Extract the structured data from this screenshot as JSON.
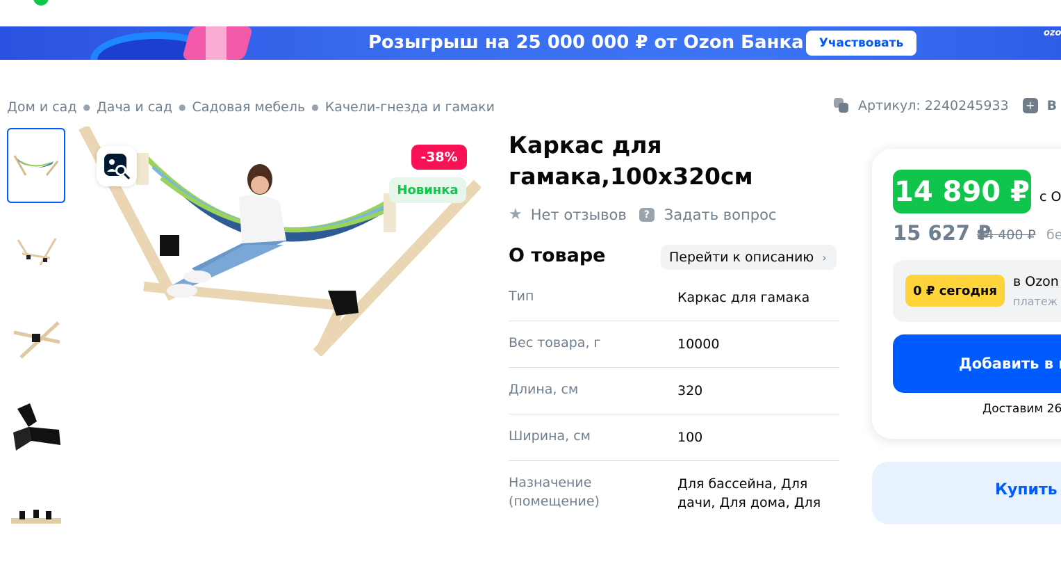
{
  "banner": {
    "title": "Розыгрыш на 25 000 000 ₽ от Ozon Банка",
    "button": "Участвовать",
    "brand": "ozon"
  },
  "breadcrumbs": [
    "Дом и сад",
    "Дача и сад",
    "Садовая мебель",
    "Качели-гнезда и гамаки"
  ],
  "article": {
    "label": "Артикул: 2240245933",
    "partial": "В"
  },
  "badges": {
    "discount": "-38%",
    "new": "Новинка"
  },
  "product": {
    "title": "Каркас для гамака,100x320см",
    "reviews": "Нет отзывов",
    "ask": "Задать вопрос"
  },
  "about": {
    "heading": "О товаре",
    "link": "Перейти к описанию",
    "specs": [
      {
        "key": "Тип",
        "value": "Каркас для гамака"
      },
      {
        "key": "Вес товара, г",
        "value": "10000"
      },
      {
        "key": "Длина, см",
        "value": "320"
      },
      {
        "key": "Ширина, см",
        "value": "100"
      },
      {
        "key": "Назначение (помещение)",
        "value": "Для бассейна, Для дачи, Для дома, Для"
      }
    ]
  },
  "price": {
    "card": "14 890 ₽",
    "card_suffix": "с О",
    "regular": "15 627 ₽",
    "old": "24 400 ₽",
    "without": "бе",
    "installment_today": "0 ₽ сегодня",
    "installment_where": "в Ozon",
    "installment_note": "платеж",
    "add_to_cart": "Добавить в к",
    "delivery": "Доставим 26",
    "buy": "Купить в"
  },
  "colors": {
    "accent": "#005bff",
    "green": "#10c44c",
    "pink": "#f91155",
    "yellow": "#ffd43b",
    "grey_text": "#707f8d"
  },
  "icons": [
    "zoom-search-icon",
    "star-icon",
    "question-icon",
    "chevron-right-icon",
    "article-copy-icon",
    "compare-icon"
  ]
}
